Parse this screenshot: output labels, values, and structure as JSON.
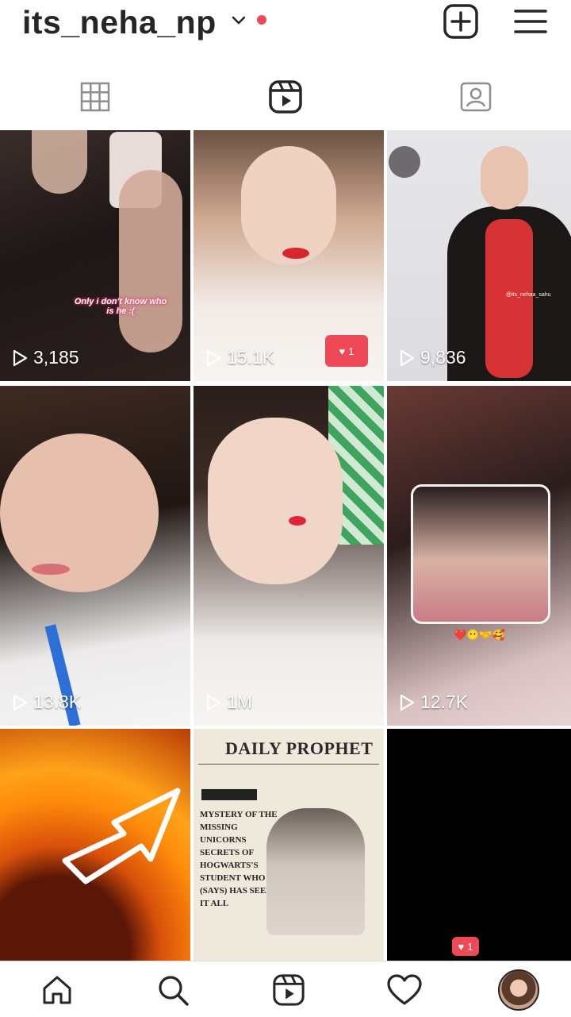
{
  "header": {
    "username": "its_neha_np",
    "icons": [
      "chevron-down-icon",
      "notification-dot",
      "create-plus-icon",
      "menu-icon"
    ]
  },
  "tabs": [
    {
      "name": "posts-grid",
      "icon": "grid-icon"
    },
    {
      "name": "reels",
      "icon": "reels-icon",
      "active": true
    },
    {
      "name": "tagged",
      "icon": "tagged-icon"
    }
  ],
  "grid": {
    "tiles": [
      {
        "views": "3,185",
        "caption": "Only i don't know who is he :("
      },
      {
        "views": "15.1K",
        "like_count": "1"
      },
      {
        "views": "9,836",
        "overlay_text": "@its_nehaa_sahu"
      },
      {
        "views": "13.8K"
      },
      {
        "views": "1M"
      },
      {
        "views": "12.7K",
        "emoji_strip": "❤️😶🤝🥰"
      },
      {
        "views": ""
      },
      {
        "views": "",
        "newspaper_title": "DAILY PROPHET",
        "newspaper_headline": "MYSTERY OF THE MISSING UNICORNS SECRETS OF HOGWARTS'S STUDENT WHO (SAYS) HAS SEEN IT ALL"
      },
      {
        "views": "",
        "like_count": "1"
      }
    ]
  },
  "navbar": {
    "items": [
      "home-icon",
      "search-icon",
      "reels-icon",
      "activity-heart-icon",
      "profile-avatar"
    ]
  },
  "colors": {
    "accent": "#ed4956",
    "text": "#262626",
    "border": "#dbdbdb"
  }
}
